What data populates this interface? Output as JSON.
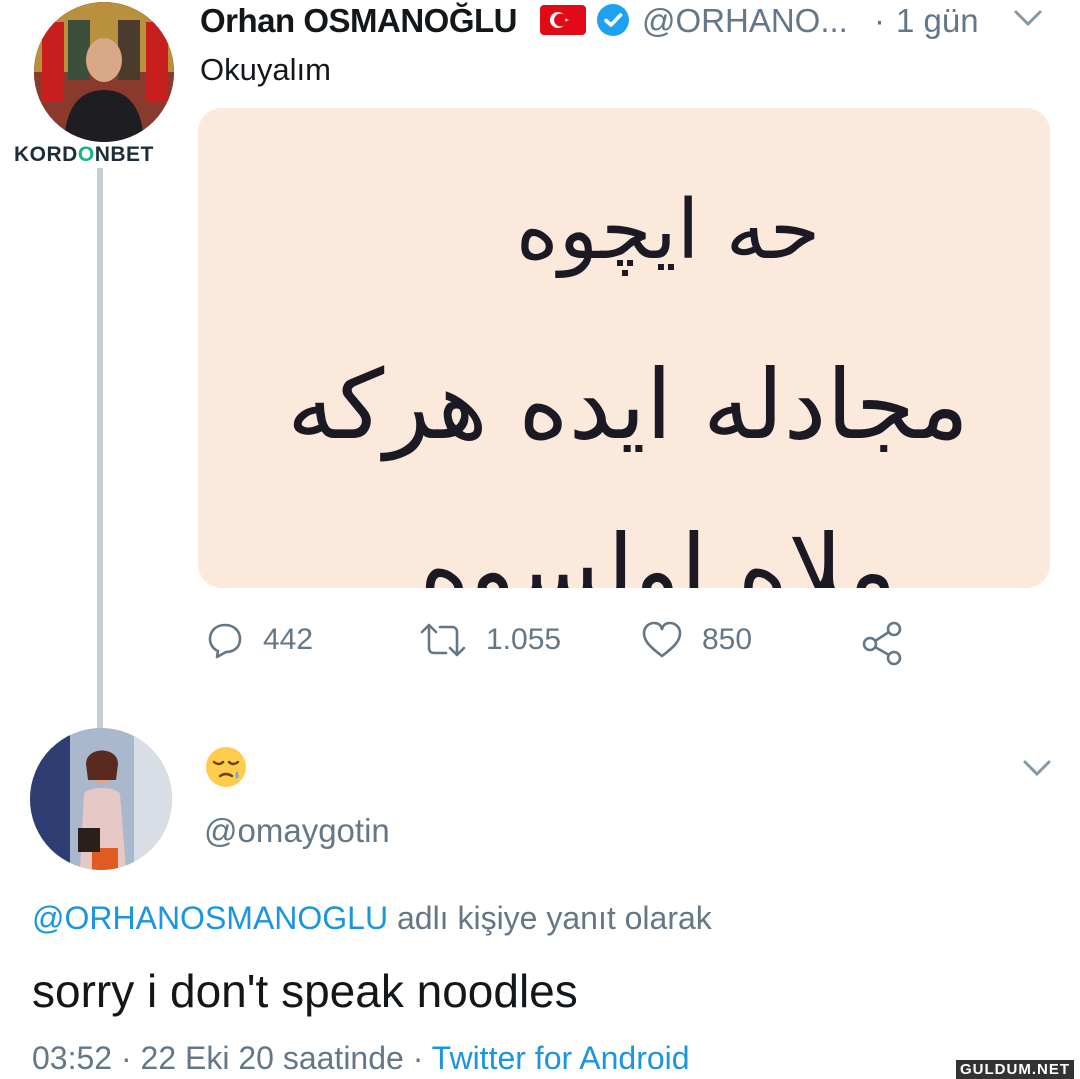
{
  "tweet": {
    "author_name": "Orhan OSMANOĞLU",
    "author_handle": "@ORHANO...",
    "separator": "·",
    "time": "1 gün",
    "text": "Okuyalım",
    "image_alt_text": [
      "حه ایچوه",
      "مجادله ایده هرکه",
      "ملاه اولسوه"
    ],
    "stats": {
      "replies": "442",
      "retweets": "1.055",
      "likes": "850"
    }
  },
  "watermark": {
    "brand_part1": "KORD",
    "brand_accent": "O",
    "brand_part2": "NBET"
  },
  "reply": {
    "display_name_emoji": "😪",
    "handle": "@omaygotin",
    "reply_to_mention": "@ORHANOSMANOGLU",
    "reply_to_suffix": " adlı kişiye yanıt olarak",
    "text": "sorry i don't speak noodles",
    "timestamp": "03:52 · 22 Eki 20 saatinde · ",
    "source": "Twitter for Android"
  },
  "site_watermark": "GULDUM.NET",
  "icons": {
    "flag": "turkey-flag-icon",
    "verified": "verified-badge-icon",
    "chevron": "chevron-down-icon",
    "reply": "reply-icon",
    "retweet": "retweet-icon",
    "like": "heart-icon",
    "share": "share-icon"
  },
  "colors": {
    "link": "#1b95e0",
    "secondary_text": "#657786",
    "thread_line": "#c4cfd6",
    "media_bg": "#fbe9dc",
    "brand_accent": "#15b586"
  }
}
